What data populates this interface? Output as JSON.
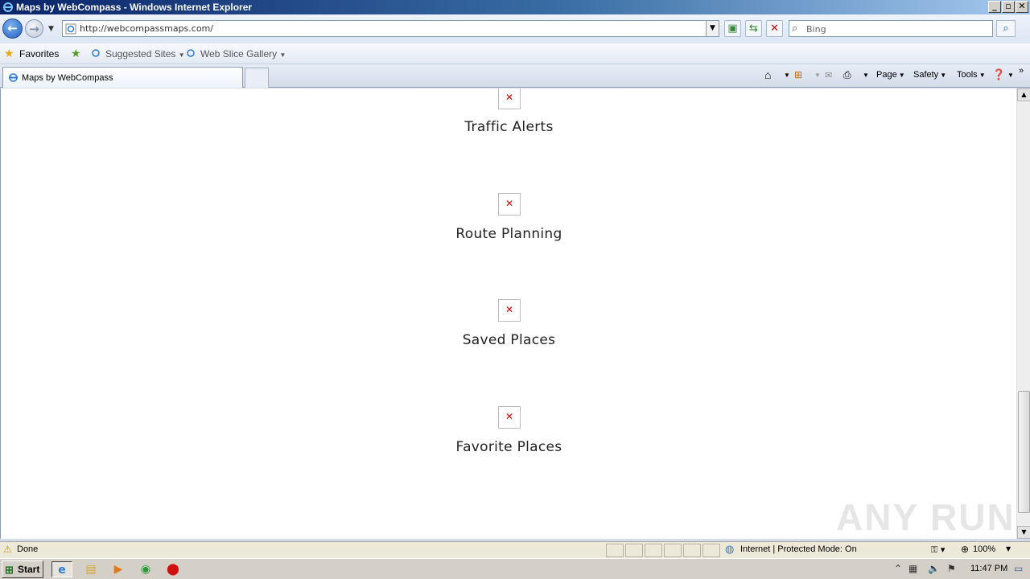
{
  "window": {
    "title": "Maps by WebCompass - Windows Internet Explorer"
  },
  "address_bar": {
    "url": "http://webcompassmaps.com/"
  },
  "search": {
    "placeholder": "Bing"
  },
  "favorites_bar": {
    "favorites_label": "Favorites",
    "suggested_sites": "Suggested Sites",
    "web_slice_gallery": "Web Slice Gallery"
  },
  "tab": {
    "label": "Maps by WebCompass"
  },
  "command_bar": {
    "page": "Page",
    "safety": "Safety",
    "tools": "Tools"
  },
  "content": {
    "features": [
      {
        "label": "Traffic Alerts"
      },
      {
        "label": "Route Planning"
      },
      {
        "label": "Saved Places"
      },
      {
        "label": "Favorite Places"
      }
    ],
    "watermark": "ANY RUN"
  },
  "status_bar": {
    "status": "Done",
    "zone": "Internet | Protected Mode: On",
    "zoom": "100%"
  },
  "taskbar": {
    "start": "Start",
    "clock": "11:47 PM"
  },
  "colors": {
    "title_bar": "#0a246a",
    "broken_image_x": "#dd0000",
    "content_bg": "#ffffff"
  }
}
